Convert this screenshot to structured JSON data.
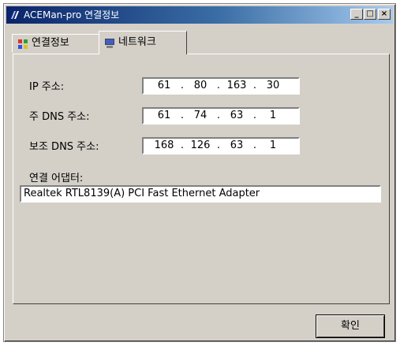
{
  "window": {
    "title": "ACEMan-pro 연결정보",
    "minimize_glyph": "_",
    "maximize_glyph": "□",
    "close_glyph": "×"
  },
  "tabs": [
    {
      "label": "연결정보",
      "icon": "connection-icon",
      "active": false
    },
    {
      "label": "네트워크",
      "icon": "network-computer-icon",
      "active": true
    }
  ],
  "network": {
    "ip": {
      "label": "IP 주소:",
      "octets": [
        "61",
        "80",
        "163",
        "30"
      ]
    },
    "primary_dns": {
      "label": "주 DNS 주소:",
      "octets": [
        "61",
        "74",
        "63",
        "1"
      ]
    },
    "secondary_dns": {
      "label": "보조 DNS 주소:",
      "octets": [
        "168",
        "126",
        "63",
        "1"
      ]
    },
    "adapter": {
      "label": "연결 어댑터:",
      "value": "Realtek RTL8139(A) PCI Fast Ethernet Adapter"
    },
    "separator": "."
  },
  "buttons": {
    "ok_label": "확인"
  },
  "colors": {
    "title_start": "#0a246a",
    "title_end": "#a6caf0",
    "face": "#d4d0c8"
  }
}
